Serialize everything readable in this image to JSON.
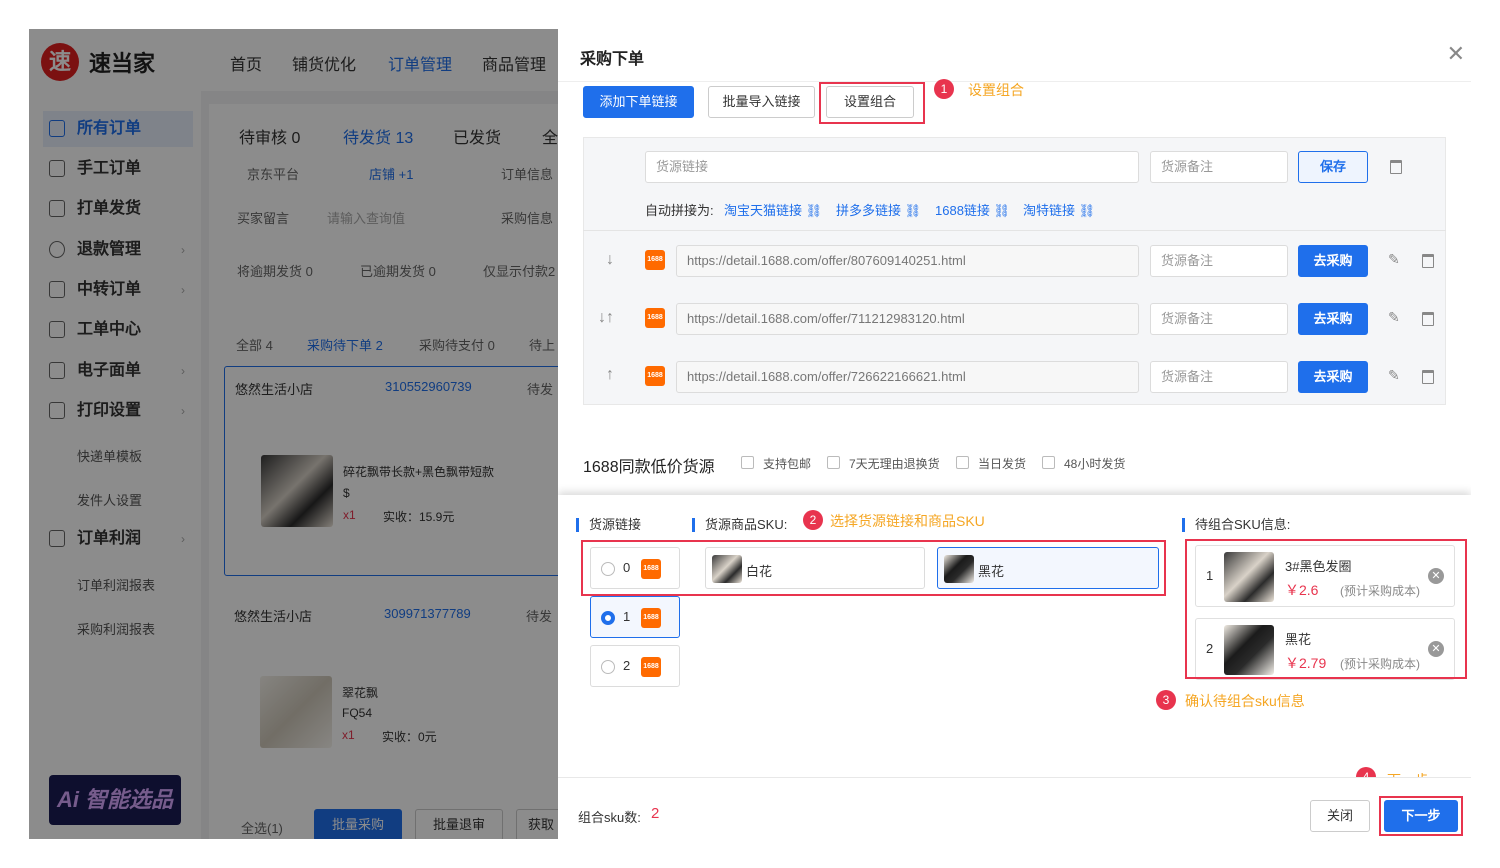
{
  "app": {
    "logo_char": "速",
    "name": "速当家"
  },
  "nav": [
    "首页",
    "铺货优化",
    "订单管理",
    "商品管理"
  ],
  "sidebar": {
    "items": [
      "所有订单",
      "手工订单",
      "打单发货",
      "退款管理",
      "中转订单",
      "工单中心",
      "电子面单",
      "打印设置"
    ],
    "sub_print": [
      "快递单模板",
      "发件人设置"
    ],
    "profit": "订单利润",
    "sub_profit": [
      "订单利润报表",
      "采购利润报表"
    ],
    "ai_banner": "Ai 智能选品"
  },
  "bg": {
    "tabs": [
      "待审核 0",
      "待发货 13",
      "已发货",
      "全"
    ],
    "filters": [
      "京东平台",
      "店铺 +1",
      "订单信息",
      "买家留言",
      "请输入查询值",
      "采购信息"
    ],
    "overdue": [
      "将逾期发货 0",
      "已逾期发货 0",
      "仅显示付款2"
    ],
    "subtabs": [
      "全部 4",
      "采购待下单 2",
      "采购待支付 0",
      "待上"
    ],
    "order1": {
      "shop": "悠然生活小店",
      "id": "310552960739",
      "status": "待发",
      "title": "碎花飘带长款+黑色飘带短款",
      "price": "$",
      "qty": "x1",
      "paid": "实收：15.9元"
    },
    "order2": {
      "shop": "悠然生活小店",
      "id": "309971377789",
      "status": "待发",
      "title": "翠花飘",
      "code": "FQ54",
      "qty": "x1",
      "paid": "实收：0元"
    },
    "bottom": {
      "select_all": "全选(1)",
      "b1": "批量采购",
      "b2": "批量退审",
      "b3": "获取"
    }
  },
  "drawer": {
    "title": "采购下单",
    "buttons": {
      "add": "添加下单链接",
      "import": "批量导入链接",
      "combo": "设置组合",
      "save": "保存",
      "buy": "去采购"
    },
    "placeholders": {
      "link": "货源链接",
      "note": "货源备注"
    },
    "auto_label": "自动拼接为:",
    "auto_links": [
      "淘宝天猫链接",
      "拼多多链接",
      "1688链接",
      "淘特链接"
    ],
    "links": [
      "https://detail.1688.com/offer/807609140251.html",
      "https://detail.1688.com/offer/711212983120.html",
      "https://detail.1688.com/offer/726622166621.html"
    ],
    "arrows": [
      "↓",
      "↓↑",
      "↑"
    ],
    "icon_1688": "1688",
    "section_title": "1688同款低价货源",
    "checks": [
      "支持包邮",
      "7天无理由退换货",
      "当日发货",
      "48小时发货"
    ],
    "combo": {
      "label_src": "货源链接",
      "label_sku": "货源商品SKU:",
      "label_pending": "待组合SKU信息:",
      "sources": [
        "0",
        "1",
        "2"
      ],
      "skus": [
        "白花",
        "黑花"
      ],
      "pending": [
        {
          "idx": "1",
          "name": "3#黑色发圈",
          "price": "￥2.6",
          "note": "(预计采购成本)"
        },
        {
          "idx": "2",
          "name": "黑花",
          "price": "￥2.79",
          "note": "(预计采购成本)"
        }
      ]
    },
    "footer": {
      "count_label": "组合sku数:",
      "count": "2",
      "close": "关闭",
      "next": "下一步"
    }
  },
  "annotations": {
    "n": [
      "1",
      "2",
      "3",
      "4"
    ],
    "t": [
      "设置组合",
      "选择货源链接和商品SKU",
      "确认待组合sku信息",
      "下一步"
    ]
  },
  "colors": {
    "accent": "#1f6feb",
    "annotation_red": "#e8344e",
    "annotation_text": "#f5a623",
    "brand_red": "#e02020"
  }
}
